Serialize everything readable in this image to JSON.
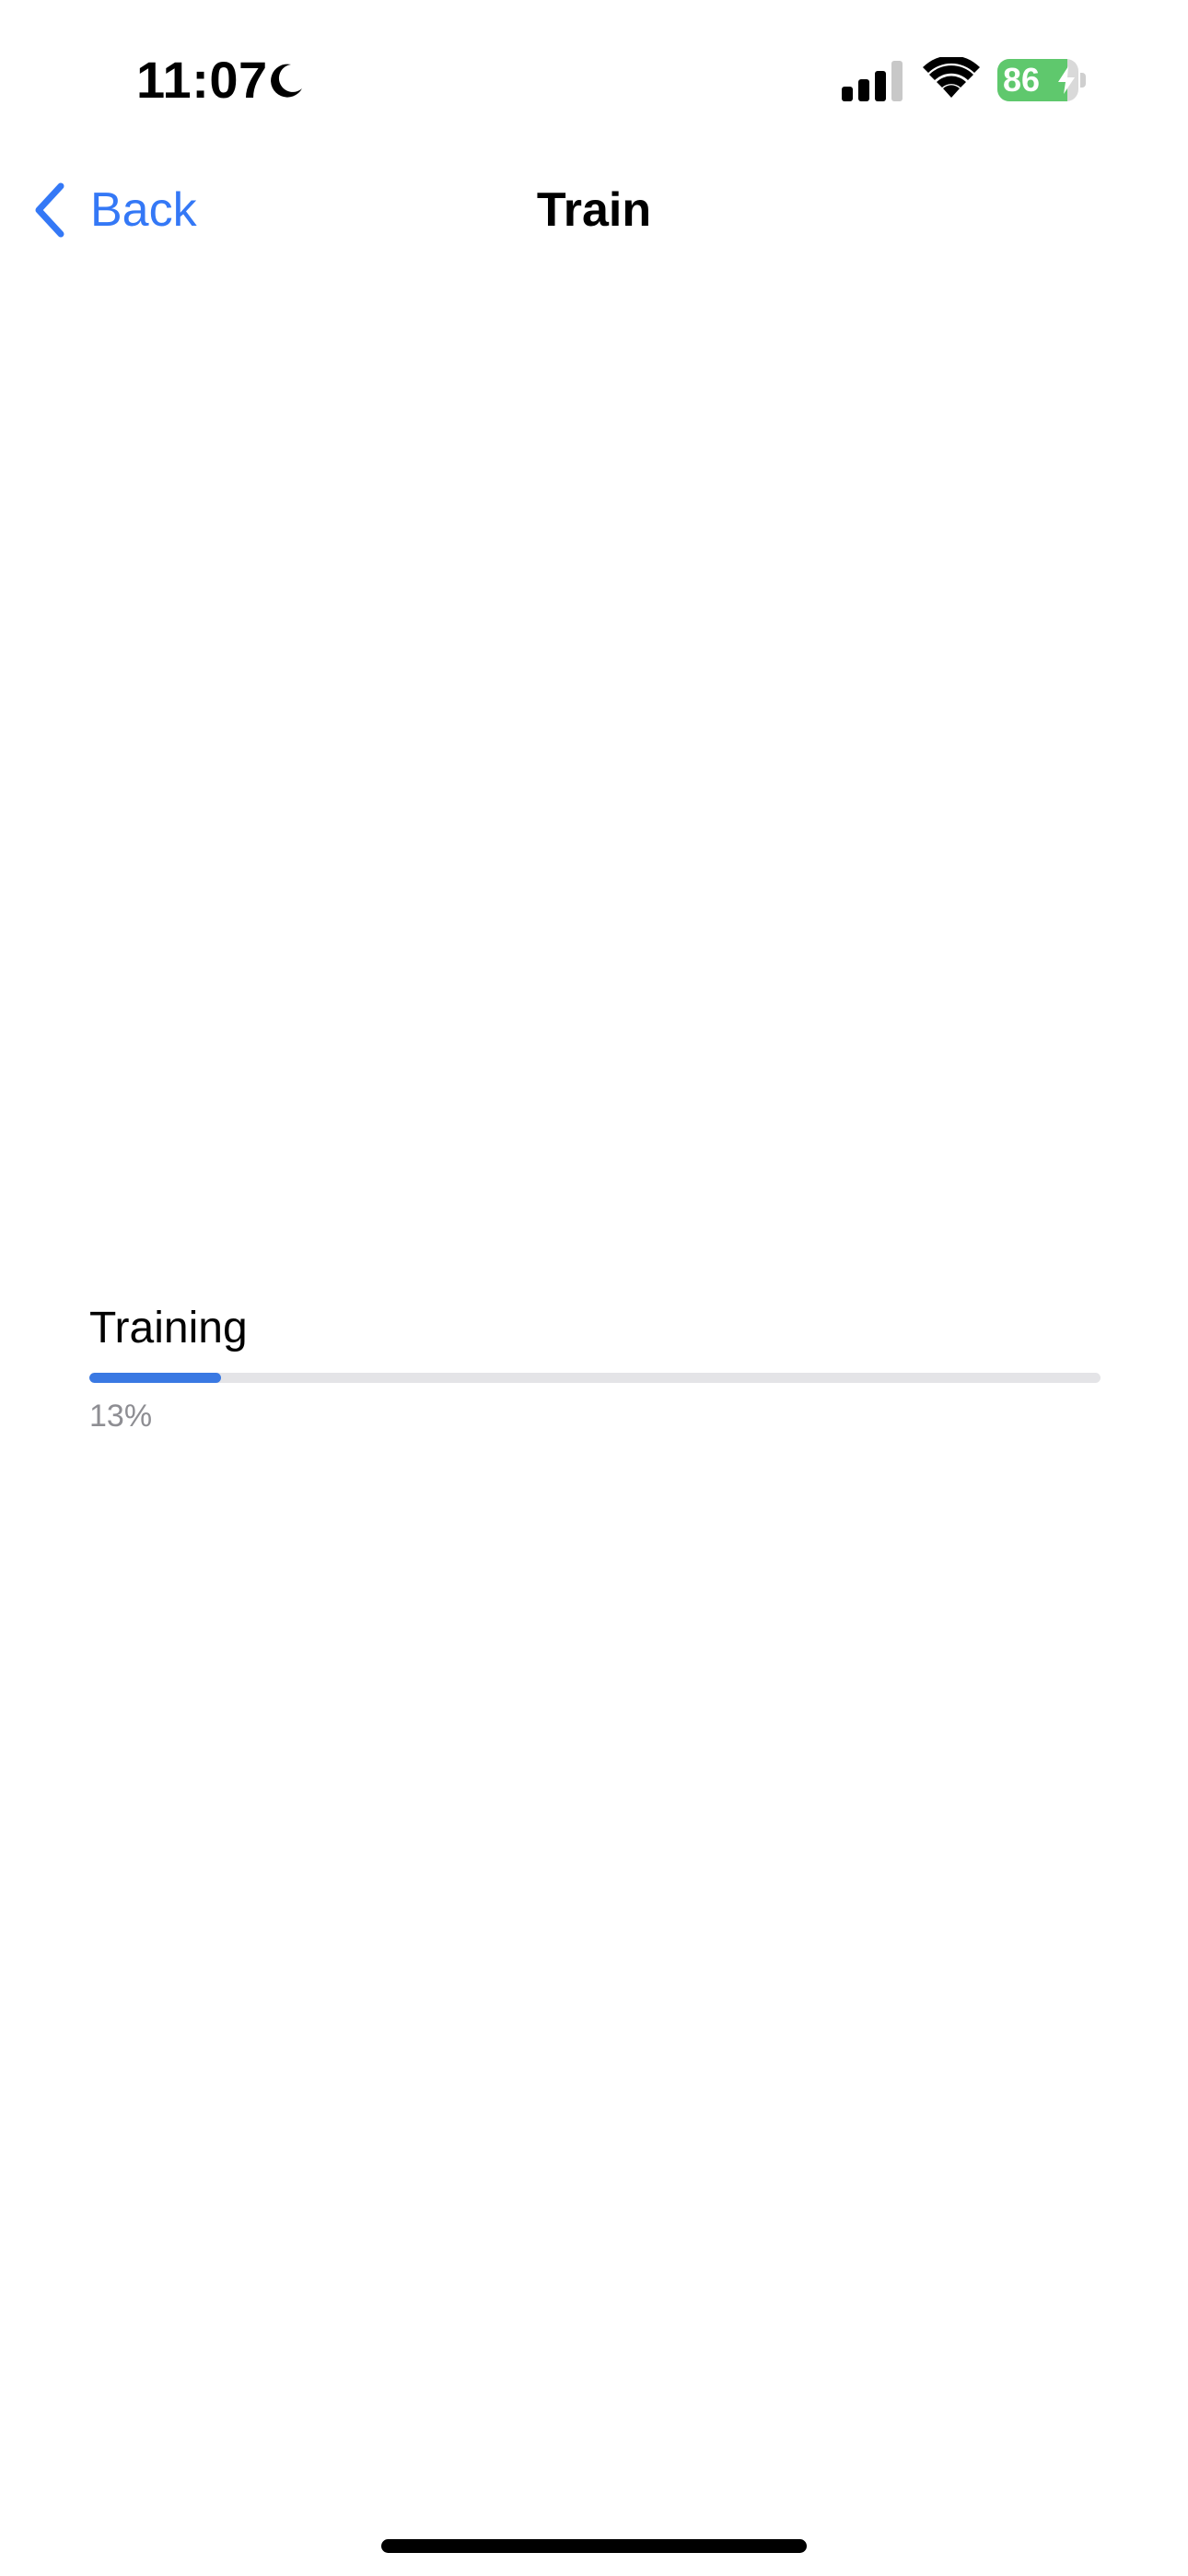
{
  "status_bar": {
    "time": "11:07",
    "battery_level": "86",
    "battery_fraction": 0.86,
    "focus_icon": "moon-icon",
    "signal_icon": "cellular-signal-icon",
    "wifi_icon": "wifi-icon",
    "charging_icon": "bolt-icon"
  },
  "nav": {
    "back_label": "Back",
    "title": "Train",
    "back_icon": "chevron-left-icon"
  },
  "progress": {
    "label": "Training",
    "percent_text": "13%",
    "value": 0.13
  },
  "colors": {
    "accent": "#3478f6",
    "progress_fill": "#3a79e3",
    "progress_track": "#e4e4e7",
    "battery_green": "#5fc86d",
    "secondary_text": "#8e8e93"
  }
}
